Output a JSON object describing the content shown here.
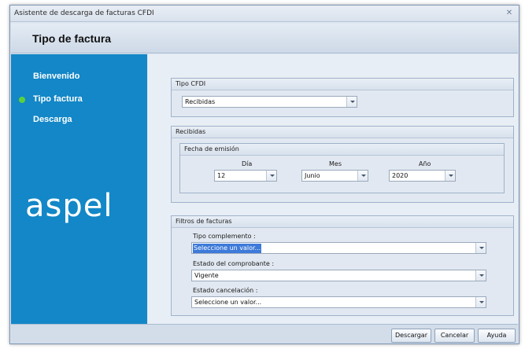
{
  "window": {
    "title": "Asistente de descarga de facturas CFDI",
    "close_glyph": "✕"
  },
  "header": {
    "title": "Tipo de factura"
  },
  "sidebar": {
    "items": [
      {
        "label": "Bienvenido",
        "active": false
      },
      {
        "label": "Tipo factura",
        "active": true
      },
      {
        "label": "Descarga",
        "active": false
      }
    ],
    "logo_text": "aspel"
  },
  "tipo_cfdi": {
    "title": "Tipo CFDI",
    "value": "Recibidas"
  },
  "recibidas": {
    "title": "Recibidas",
    "fecha": {
      "title": "Fecha de emisión",
      "dia_label": "Día",
      "dia_value": "12",
      "mes_label": "Mes",
      "mes_value": "Junio",
      "anio_label": "Año",
      "anio_value": "2020"
    }
  },
  "filtros": {
    "title": "Filtros de facturas",
    "tipo_complemento_label": "Tipo complemento :",
    "tipo_complemento_value": "Seleccione un valor...",
    "estado_comprobante_label": "Estado del comprobante :",
    "estado_comprobante_value": "Vigente",
    "estado_cancelacion_label": "Estado cancelación :",
    "estado_cancelacion_value": "Seleccione un valor..."
  },
  "footer": {
    "descargar": "Descargar",
    "cancelar": "Cancelar",
    "ayuda": "Ayuda"
  },
  "colors": {
    "sidebar": "#1387c7",
    "active_dot": "#5ad13c",
    "selection": "#3d7ad9"
  },
  "icons": {
    "close": "close-icon",
    "active": "active-step-icon",
    "dropdown": "chevron-down-icon"
  }
}
